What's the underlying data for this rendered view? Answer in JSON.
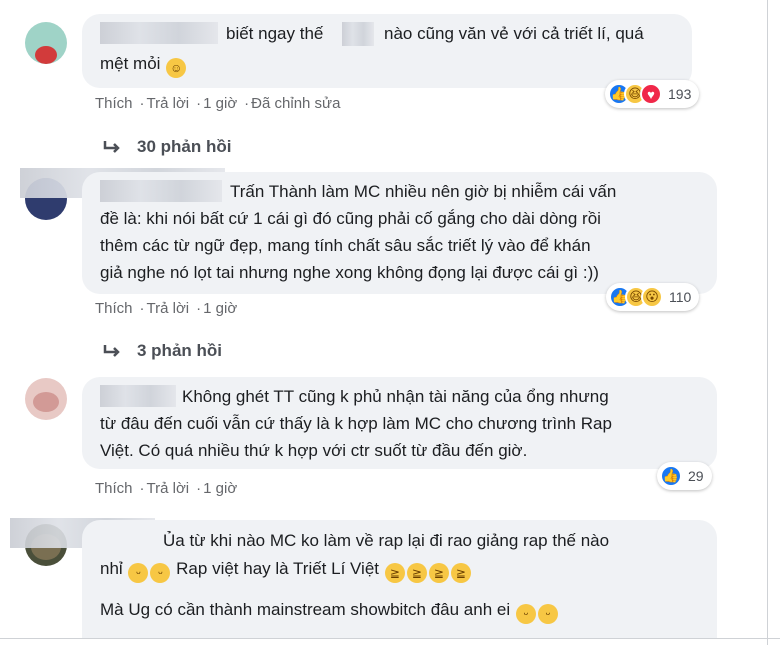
{
  "comments": [
    {
      "text_lines": [
        "biết ngay thế",
        "nào cũng văn vẻ với cả triết lí, quá",
        "mệt mỏi"
      ],
      "meta": [
        "Thích",
        "Trả lời",
        "1 giờ",
        "Đã chỉnh sửa"
      ],
      "reactions": {
        "icons": [
          "like-icon",
          "haha-icon",
          "love-icon"
        ],
        "count": "193"
      },
      "replies": "30 phản hồi"
    },
    {
      "text_lines": [
        "Trấn Thành làm MC nhiều nên giờ bị nhiễm cái vấn",
        "đề là: khi nói bất cứ 1 cái gì đó cũng phải cố gắng cho dài dòng rồi",
        "thêm các từ ngữ đẹp, mang tính chất sâu sắc triết lý vào để khán",
        "giả nghe nó lọt tai nhưng nghe xong không đọng lại được cái gì :))"
      ],
      "meta": [
        "Thích",
        "Trả lời",
        "1 giờ"
      ],
      "reactions": {
        "icons": [
          "like-icon",
          "haha-icon",
          "wow-icon"
        ],
        "count": "110"
      },
      "replies": "3 phản hồi"
    },
    {
      "text_lines": [
        "Không ghét TT cũng k phủ nhận tài năng của ổng nhưng",
        "từ đâu đến cuối vẫn cứ thấy là k hợp làm MC cho chương trình Rap",
        "Việt. Có quá nhiều thứ k hợp với ctr suốt từ đầu đến giờ."
      ],
      "meta": [
        "Thích",
        "Trả lời",
        "1 giờ"
      ],
      "reactions": {
        "icons": [
          "like-icon"
        ],
        "count": "29"
      }
    },
    {
      "text_lines": [
        "Ủa từ khi nào MC ko làm về rap lại đi rao giảng rap thế nào",
        "nhỉ",
        "Rap việt hay là Triết Lí Việt",
        "Mà Ug có cần thành mainstream showbitch đâu anh ei"
      ]
    }
  ]
}
